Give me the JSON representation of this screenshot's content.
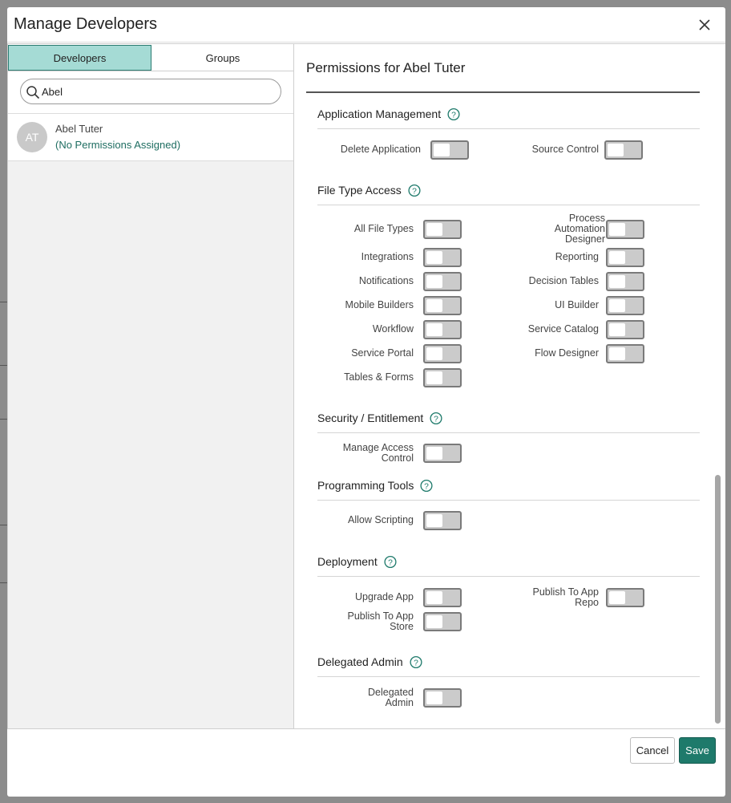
{
  "modal": {
    "title": "Manage Developers",
    "close_label": "×"
  },
  "left": {
    "tabs": [
      {
        "label": "Developers",
        "active": true
      },
      {
        "label": "Groups",
        "active": false
      }
    ],
    "search": {
      "value": "Abel",
      "placeholder": "Search"
    },
    "users": [
      {
        "initials": "AT",
        "name": "Abel Tuter",
        "status": "(No Permissions Assigned)"
      }
    ]
  },
  "permissions": {
    "title": "Permissions for Abel Tuter",
    "sections": [
      {
        "heading": "Application Management",
        "items": [
          "Delete Application",
          "Source Control"
        ]
      },
      {
        "heading": "File Type Access",
        "items": [
          "All File Types",
          "Process Automation Designer",
          "Integrations",
          "Reporting",
          "Notifications",
          "Decision Tables",
          "Mobile Builders",
          "UI Builder",
          "Workflow",
          "Service Catalog",
          "Service Portal",
          "Flow Designer",
          "Tables & Forms"
        ]
      },
      {
        "heading": "Security / Entitlement",
        "items": [
          "Manage Access Control"
        ]
      },
      {
        "heading": "Programming Tools",
        "items": [
          "Allow Scripting"
        ]
      },
      {
        "heading": "Deployment",
        "items": [
          "Upgrade App",
          "Publish To App Repo",
          "Publish To App Store"
        ]
      },
      {
        "heading": "Delegated Admin",
        "items": [
          "Delegated Admin"
        ]
      }
    ]
  },
  "footer": {
    "cancel_label": "Cancel",
    "save_label": "Save"
  },
  "colors": {
    "accent": "#1e7a6b",
    "tab_active_bg": "#a5dbd5",
    "status_text": "#1e6d61",
    "toggle_off": "#cbcbcb"
  }
}
